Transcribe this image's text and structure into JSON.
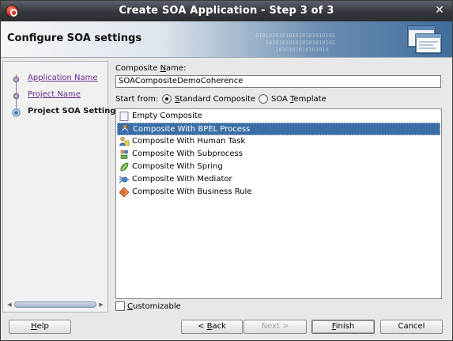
{
  "window": {
    "title": "Create SOA Application - Step 3 of 3",
    "close_glyph": "✕"
  },
  "header": {
    "title": "Configure SOA settings",
    "binary_art": "010101010101010101010101\n   101010101010101010101\n      1010101010101010"
  },
  "nav": {
    "items": [
      {
        "label": "Application Name",
        "state": "visited"
      },
      {
        "label": "Project Name",
        "state": "visited"
      },
      {
        "label": "Project SOA Settings",
        "state": "current"
      }
    ]
  },
  "form": {
    "composite_name_label_pre": "Composite ",
    "composite_name_label_mn": "N",
    "composite_name_label_post": "ame:",
    "composite_name_value": "SOACompositeDemoCoherence",
    "start_from_label": "Start from:",
    "standard_label_mn": "S",
    "standard_label_rest": "tandard Composite",
    "template_label_pre": "SOA ",
    "template_label_mn": "T",
    "template_label_rest": "emplate",
    "customizable_mn": "C",
    "customizable_rest": "ustomizable"
  },
  "templates": [
    {
      "label": "Empty Composite",
      "icon": "empty-composite-icon",
      "selected": false
    },
    {
      "label": "Composite With BPEL Process",
      "icon": "bpel-process-icon",
      "selected": true
    },
    {
      "label": "Composite With Human Task",
      "icon": "human-task-icon",
      "selected": false
    },
    {
      "label": "Composite With Subprocess",
      "icon": "subprocess-icon",
      "selected": false
    },
    {
      "label": "Composite With Spring",
      "icon": "spring-icon",
      "selected": false
    },
    {
      "label": "Composite With Mediator",
      "icon": "mediator-icon",
      "selected": false
    },
    {
      "label": "Composite With Business Rule",
      "icon": "business-rule-icon",
      "selected": false
    }
  ],
  "buttons": {
    "help_mn": "H",
    "help_rest": "elp",
    "back_pre": "< ",
    "back_mn": "B",
    "back_rest": "ack",
    "next": "Next >",
    "finish_mn": "F",
    "finish_rest": "inish",
    "cancel": "Cancel"
  },
  "colors": {
    "selection": "#3b6ea5",
    "link": "#6b2a8a",
    "titlebar": "#34373d"
  }
}
